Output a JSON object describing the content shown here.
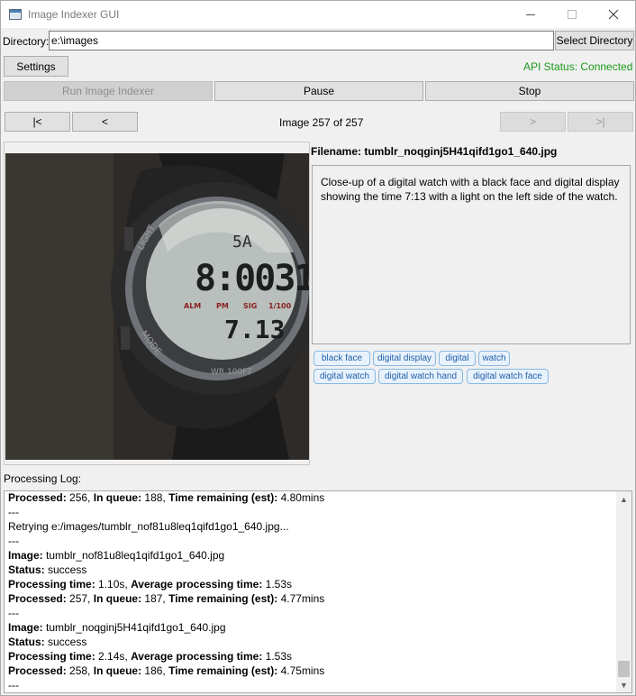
{
  "window": {
    "title": "Image Indexer GUI"
  },
  "toolbar": {
    "directory_label": "Directory:",
    "directory_value": "e:\\images",
    "select_directory": "Select Directory",
    "settings": "Settings",
    "api_status": "API Status: Connected",
    "run": "Run Image Indexer",
    "pause": "Pause",
    "stop": "Stop"
  },
  "nav": {
    "first": "|<",
    "prev": "<",
    "counter": "Image 257 of 257",
    "next": ">",
    "last": ">|"
  },
  "details": {
    "filename": "Filename: tumblr_noqginj5H41qifd1go1_640.jpg",
    "description": "Close-up of a digital watch with a black face and digital display showing the time 7:13 with a light on the left side of the watch.",
    "tags": [
      "black face",
      "digital display",
      "digital",
      "watch",
      "digital watch",
      "digital watch hand",
      "digital watch face"
    ]
  },
  "watch": {
    "top": "5A",
    "time": "8:0031",
    "row": [
      "ALM",
      "PM",
      "SIG",
      "1/100"
    ],
    "bottom": "7.13",
    "light": "LIGHT",
    "mode": "MODE",
    "wr": "WR 100FT"
  },
  "log": {
    "label": "Processing Log:",
    "lines": [
      [
        {
          "b": "Processed:"
        },
        {
          "t": " 256, "
        },
        {
          "b": "In queue:"
        },
        {
          "t": " 188, "
        },
        {
          "b": "Time remaining (est):"
        },
        {
          "t": " 4.80mins"
        }
      ],
      [
        {
          "t": "---"
        }
      ],
      [
        {
          "t": "Retrying e:/images/tumblr_nof81u8leq1qifd1go1_640.jpg..."
        }
      ],
      [
        {
          "t": "---"
        }
      ],
      [
        {
          "b": "Image:"
        },
        {
          "t": " tumblr_nof81u8leq1qifd1go1_640.jpg"
        }
      ],
      [
        {
          "b": "Status:"
        },
        {
          "t": " success"
        }
      ],
      [
        {
          "b": "Processing time:"
        },
        {
          "t": " 1.10s, "
        },
        {
          "b": "Average processing time:"
        },
        {
          "t": " 1.53s"
        }
      ],
      [
        {
          "b": "Processed:"
        },
        {
          "t": " 257, "
        },
        {
          "b": "In queue:"
        },
        {
          "t": " 187, "
        },
        {
          "b": "Time remaining (est):"
        },
        {
          "t": " 4.77mins"
        }
      ],
      [
        {
          "t": "---"
        }
      ],
      [
        {
          "b": "Image:"
        },
        {
          "t": " tumblr_noqginj5H41qifd1go1_640.jpg"
        }
      ],
      [
        {
          "b": "Status:"
        },
        {
          "t": " success"
        }
      ],
      [
        {
          "b": "Processing time:"
        },
        {
          "t": " 2.14s, "
        },
        {
          "b": "Average processing time:"
        },
        {
          "t": " 1.53s"
        }
      ],
      [
        {
          "b": "Processed:"
        },
        {
          "t": " 258, "
        },
        {
          "b": "In queue:"
        },
        {
          "t": " 186, "
        },
        {
          "b": "Time remaining (est):"
        },
        {
          "t": " 4.75mins"
        }
      ],
      [
        {
          "t": "---"
        }
      ]
    ]
  }
}
